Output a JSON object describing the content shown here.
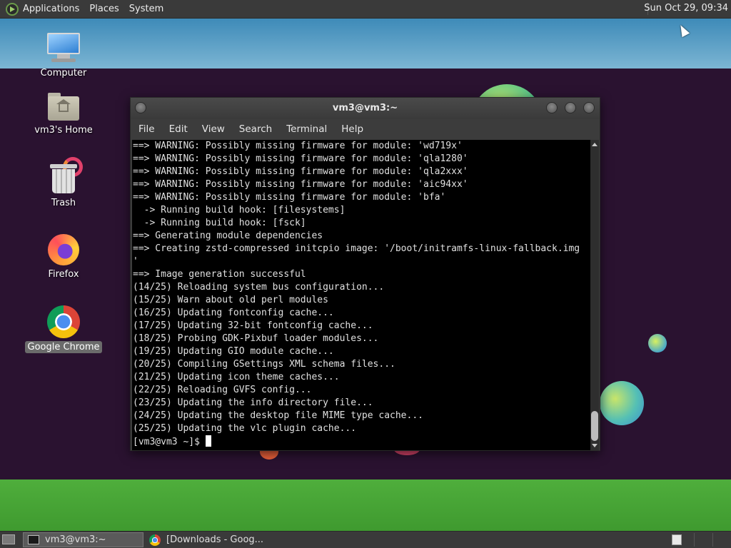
{
  "top_panel": {
    "menus": [
      "Applications",
      "Places",
      "System"
    ],
    "clock": "Sun Oct 29, 09:34"
  },
  "desktop_icons": [
    {
      "label": "Computer",
      "icon": "computer-icon"
    },
    {
      "label": "vm3's Home",
      "icon": "home-folder-icon"
    },
    {
      "label": "Trash",
      "icon": "trash-icon"
    },
    {
      "label": "Firefox",
      "icon": "firefox-icon"
    },
    {
      "label": "Google Chrome",
      "icon": "chrome-icon",
      "selected": true
    }
  ],
  "terminal": {
    "title": "vm3@vm3:~",
    "menu": [
      "File",
      "Edit",
      "View",
      "Search",
      "Terminal",
      "Help"
    ],
    "lines": [
      "==> WARNING: Possibly missing firmware for module: 'wd719x'",
      "==> WARNING: Possibly missing firmware for module: 'qla1280'",
      "==> WARNING: Possibly missing firmware for module: 'qla2xxx'",
      "==> WARNING: Possibly missing firmware for module: 'aic94xx'",
      "==> WARNING: Possibly missing firmware for module: 'bfa'",
      "  -> Running build hook: [filesystems]",
      "  -> Running build hook: [fsck]",
      "==> Generating module dependencies",
      "==> Creating zstd-compressed initcpio image: '/boot/initramfs-linux-fallback.img",
      "'",
      "==> Image generation successful",
      "(14/25) Reloading system bus configuration...",
      "(15/25) Warn about old perl modules",
      "(16/25) Updating fontconfig cache...",
      "(17/25) Updating 32-bit fontconfig cache...",
      "(18/25) Probing GDK-Pixbuf loader modules...",
      "(19/25) Updating GIO module cache...",
      "(20/25) Compiling GSettings XML schema files...",
      "(21/25) Updating icon theme caches...",
      "(22/25) Reloading GVFS config...",
      "(23/25) Updating the info directory file...",
      "(24/25) Updating the desktop file MIME type cache...",
      "(25/25) Updating the vlc plugin cache..."
    ],
    "prompt": "[vm3@vm3 ~]$ "
  },
  "taskbar": {
    "tasks": [
      {
        "label": "vm3@vm3:~",
        "icon": "terminal-icon",
        "active": true
      },
      {
        "label": "[Downloads - Goog...",
        "icon": "chrome-icon",
        "active": false
      }
    ]
  }
}
